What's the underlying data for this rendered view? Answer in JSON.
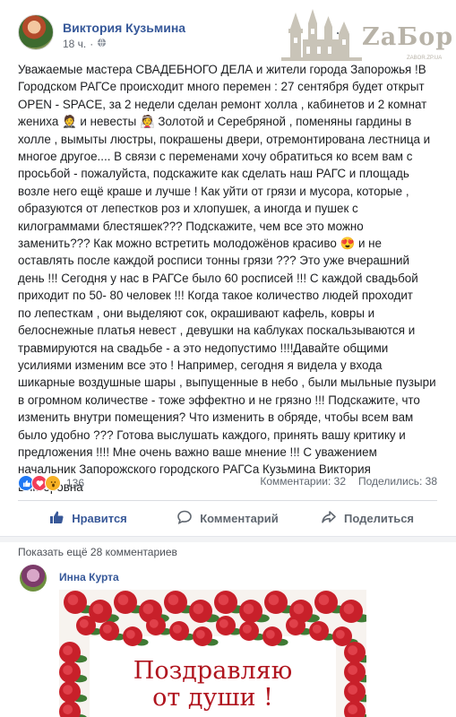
{
  "post": {
    "author": "Виктория Кузьмина",
    "time": "18 ч.",
    "privacy_icon": "globe-icon",
    "more_icon": "ellipsis-icon",
    "watermark": {
      "brand": "ZaБор",
      "domain": "ZABOR.ZP.UA"
    },
    "body_lines": [
      "Уважаемые мастера СВАДЕБНОГО ДЕЛА и жители города Запорожья !В",
      "Городском РАГСе происходит много перемен : 27 сентября будет открыт",
      "OPEN - SPACE, за 2 недели сделан ремонт холла , кабинетов и 2 комнат",
      "жениха 🤵 и невесты 👰 Золотой и Серебряной , поменяны гардины в",
      "холле , вымыты люстры, покрашены двери, отремонтирована лестница и",
      "многое другое.... В связи с переменами хочу обратиться ко всем вам с",
      "просьбой - пожалуйста, подскажите как сделать наш РАГС и площадь",
      "возле него ещё краше и лучше ! Как уйти от грязи и мусора, которые ,",
      "образуются от лепестков роз и хлопушек, а иногда и пушек с",
      "килограммами блестяшек??? Подскажите, чем все это можно",
      "заменить??? Как можно встретить молодожёнов красиво 😍 и не",
      "оставлять после каждой росписи тонны грязи ??? Это уже вчерашний",
      "день !!! Сегодня у нас в РАГСе было 60 росписей !!! С каждой свадьбой",
      "приходит по 50- 80 человек !!! Когда такое количество людей проходит",
      "по лепесткам , они выделяют сок, окрашивают кафель, ковры и",
      "белоснежные платья невест , девушки на каблуках поскальзываются и",
      "травмируются на свадьбе - а это недопустимо !!!!Давайте общими",
      "усилиями изменим все это ! Например, сегодня я видела у входа",
      "шикарные воздушные шары , выпущенные в небо , были мыльные пузыри",
      "в огромном количестве - тоже эффектно и не грязно !!! Подскажите, что",
      "изменить внутри помещения? Что изменить в обряде, чтобы всем вам",
      "было удобно ??? Готова выслушать каждого, принять вашу критику и",
      "предложения !!!! Мне очень важно ваше мнение !!! С уважением",
      "начальник Запорожского городского РАГСа Кузьмина Виктория",
      "Викторовна"
    ]
  },
  "stats": {
    "reaction_icons": [
      "like-icon",
      "love-icon",
      "wow-icon"
    ],
    "reaction_count": "136",
    "comments": "Комментарии: 32",
    "shares": "Поделились: 38"
  },
  "actions": {
    "like": "Нравится",
    "comment": "Комментарий",
    "share": "Поделиться"
  },
  "comments_section": {
    "show_more": "Показать ещё 28 комментариев",
    "comment": {
      "author": "Инна Курта",
      "image_text": "Поздравляю\nот души !"
    }
  },
  "colors": {
    "link_blue": "#365899",
    "liked_blue": "#385898",
    "muted": "#606770",
    "rose_red": "#c8202a",
    "leaf_green": "#3f7a34"
  }
}
